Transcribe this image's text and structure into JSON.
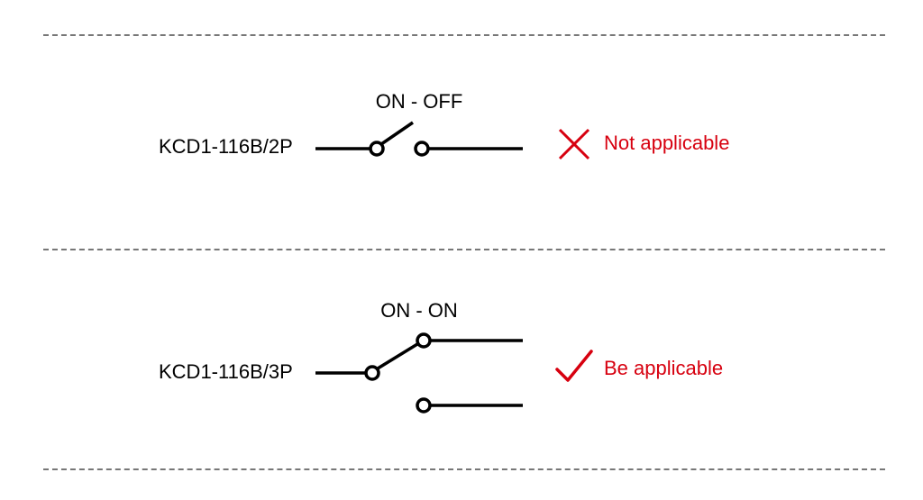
{
  "rows": [
    {
      "part": "KCD1-116B/2P",
      "state": "ON - OFF",
      "verdict": "Not applicable",
      "mark": "cross"
    },
    {
      "part": "KCD1-116B/3P",
      "state": "ON - ON",
      "verdict": "Be applicable",
      "mark": "check"
    }
  ],
  "colors": {
    "verdict": "#d7000f",
    "dashed": "#777",
    "stroke": "#000"
  }
}
